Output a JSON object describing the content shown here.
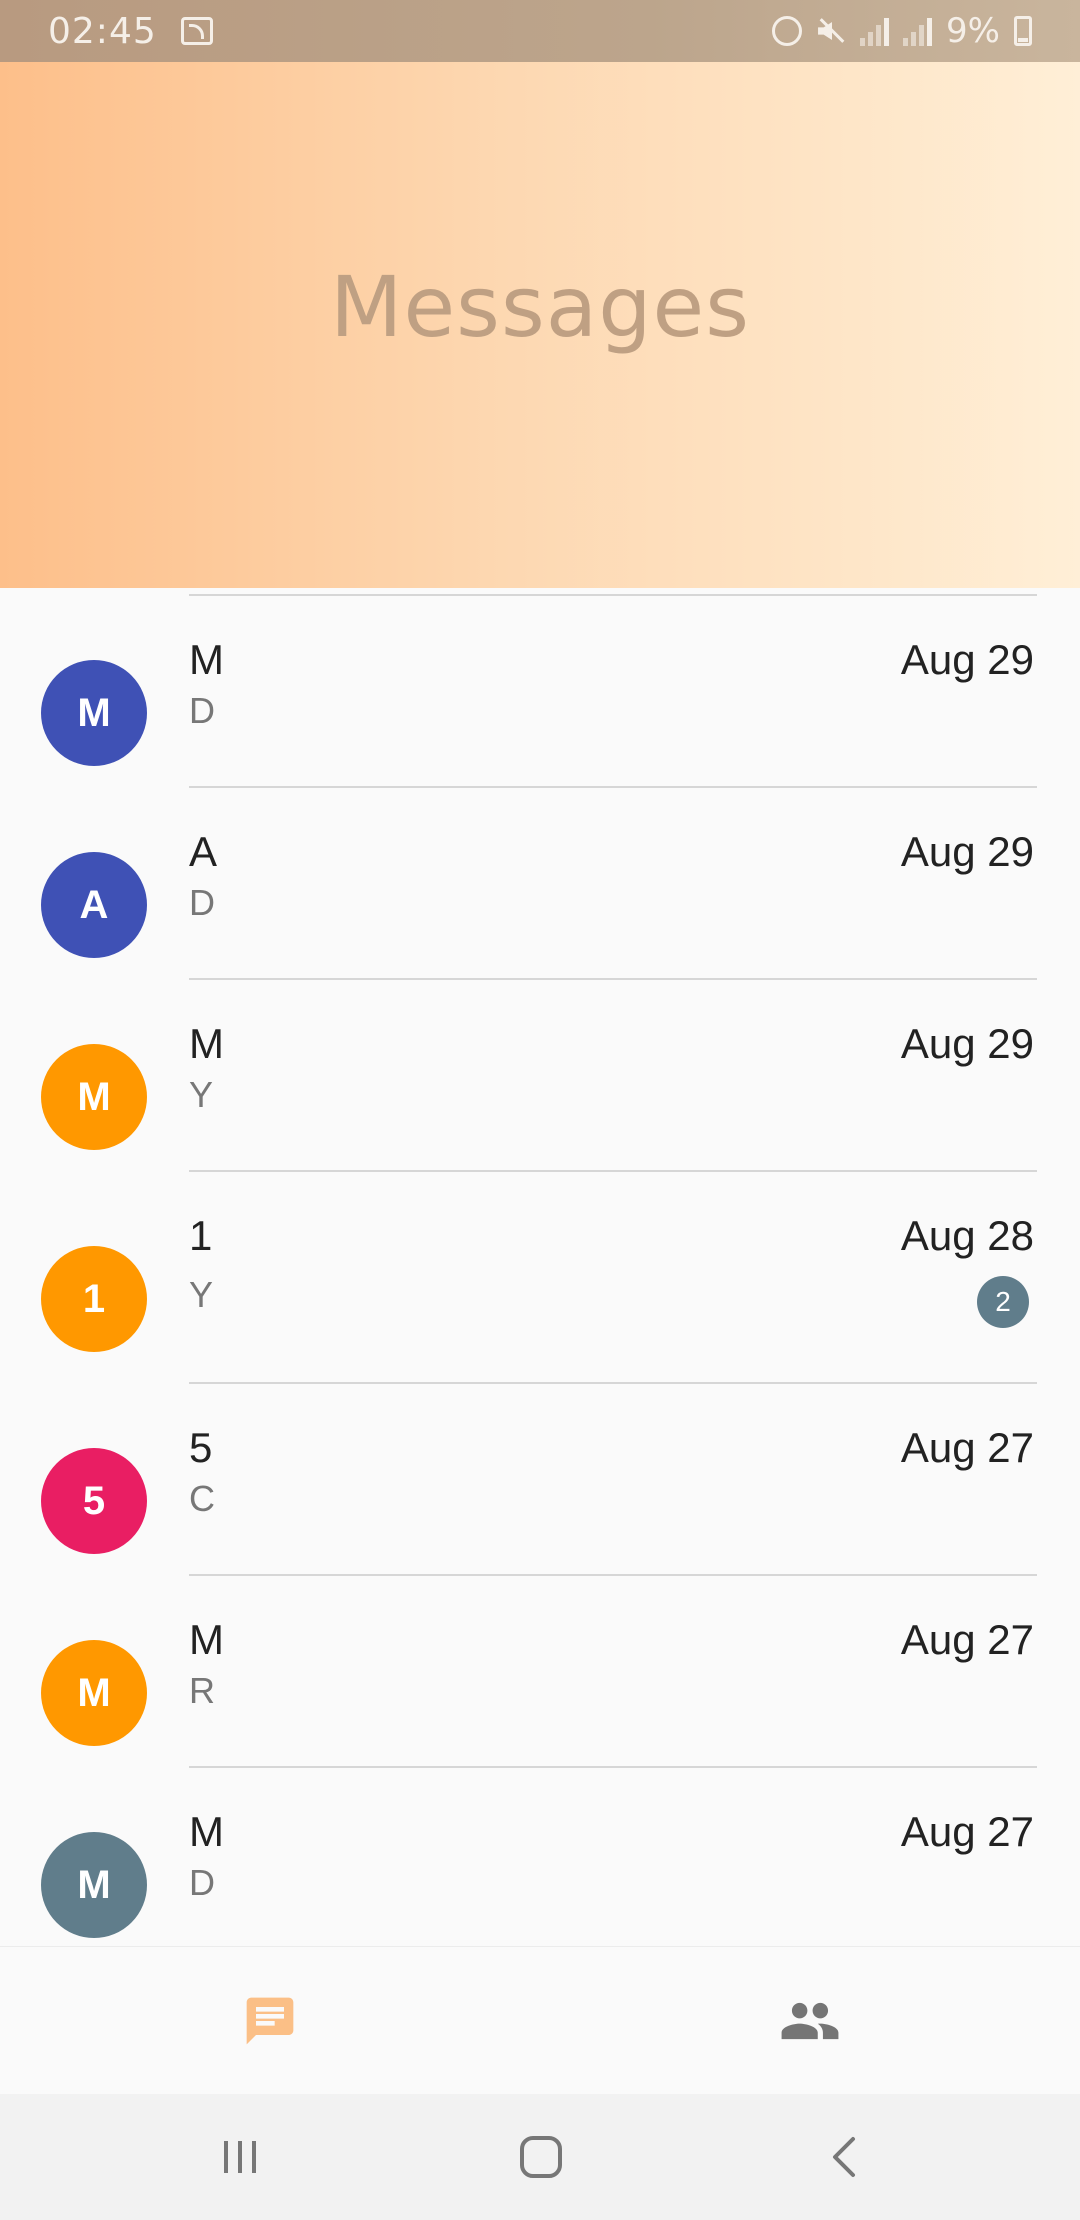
{
  "status_bar": {
    "time": "02:45",
    "battery": "9%"
  },
  "header": {
    "title": "Messages"
  },
  "conversations": [
    {
      "initial": "M",
      "name": "M",
      "preview": "D",
      "date": "Aug 29",
      "color": "#3f51b5",
      "unread": null
    },
    {
      "initial": "A",
      "name": "A",
      "preview": "D",
      "date": "Aug 29",
      "color": "#3f51b5",
      "unread": null
    },
    {
      "initial": "M",
      "name": "M",
      "preview": "Y",
      "date": "Aug 29",
      "color": "#ff9800",
      "unread": null
    },
    {
      "initial": "1",
      "name": "1",
      "preview": "Y",
      "date": "Aug 28",
      "color": "#ff9800",
      "unread": "2"
    },
    {
      "initial": "5",
      "name": "5",
      "preview": "C",
      "date": "Aug 27",
      "color": "#e91e63",
      "unread": null
    },
    {
      "initial": "M",
      "name": "M",
      "preview": "R",
      "date": "Aug 27",
      "color": "#ff9800",
      "unread": null
    },
    {
      "initial": "M",
      "name": "M",
      "preview": "D",
      "date": "Aug 27",
      "color": "#607d8b",
      "unread": null
    }
  ],
  "bottom_nav": {
    "tabs": [
      {
        "icon": "chat-icon",
        "active": true,
        "color": "#fbbf86"
      },
      {
        "icon": "contacts-icon",
        "active": false,
        "color": "#757575"
      }
    ]
  },
  "system_nav": {
    "buttons": [
      "recents-icon",
      "home-icon",
      "back-icon"
    ]
  }
}
